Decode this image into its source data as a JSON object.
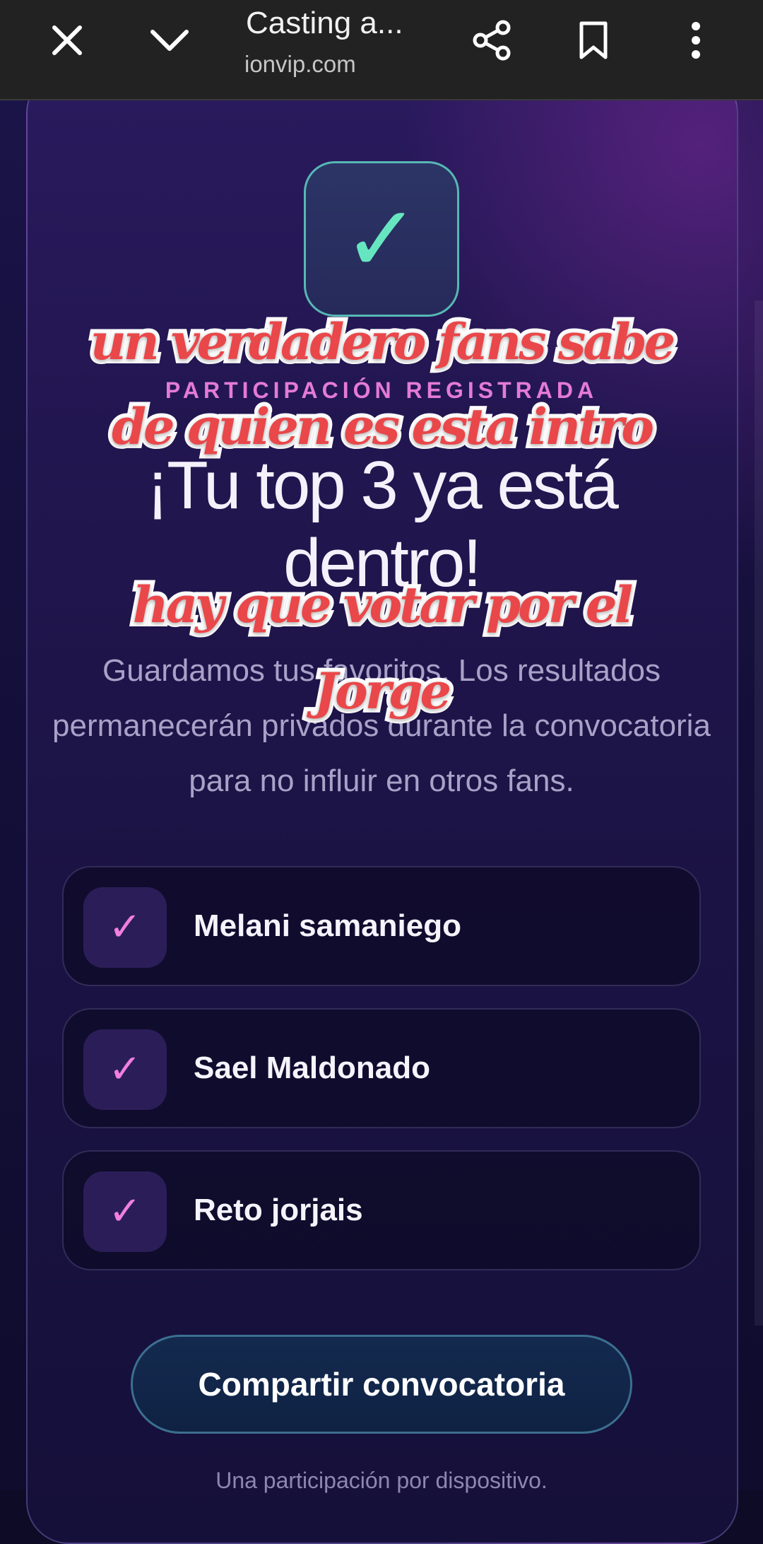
{
  "browser": {
    "title": "Casting a...",
    "url": "ionvip.com"
  },
  "card": {
    "kicker": "PARTICIPACIÓN REGISTRADA",
    "headline": "¡Tu top 3 ya está dentro!",
    "body": "Guardamos tus favoritos. Los resultados permanecerán privados durante la convocatoria para no influir en otros fans.",
    "check_icon": "✓",
    "accent_color": "#66e6c0",
    "selections": [
      {
        "name": "Melani samaniego",
        "check": "✓"
      },
      {
        "name": "Sael Maldonado",
        "check": "✓"
      },
      {
        "name": "Reto jorjais",
        "check": "✓"
      }
    ],
    "share_button": "Compartir convocatoria",
    "footnote": "Una participación por dispositivo."
  },
  "captions": {
    "line1": "un verdadero fans sabe",
    "line2": "de quien es esta intro",
    "line3": "hay que votar por el",
    "line4": "Jorge"
  }
}
